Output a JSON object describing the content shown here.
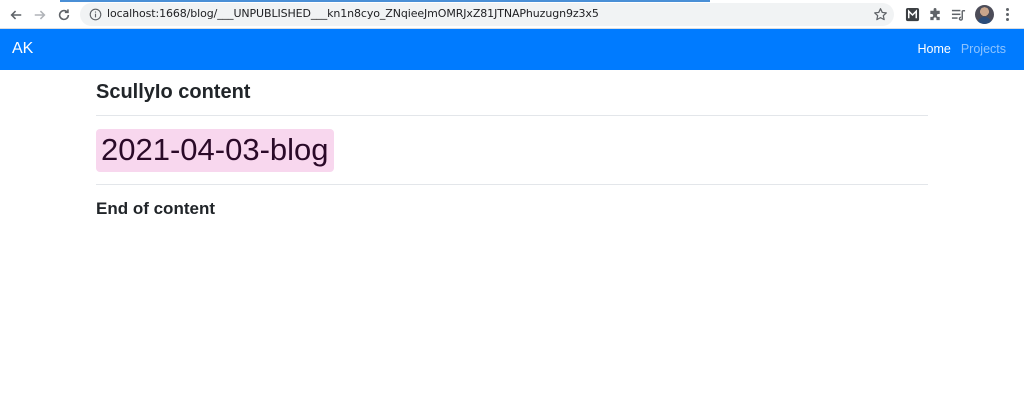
{
  "browser": {
    "url": "localhost:1668/blog/___UNPUBLISHED___kn1n8cyo_ZNqieeJmOMRJxZ81JTNAPhuzugn9z3x5",
    "icons": [
      "back-arrow-icon",
      "forward-arrow-icon",
      "reload-icon",
      "info-icon",
      "star-icon",
      "m-extension-icon",
      "puzzle-icon",
      "playlist-icon",
      "profile-avatar",
      "menu-dots-icon"
    ]
  },
  "navbar": {
    "brand": "AK",
    "links": [
      {
        "label": "Home",
        "active": true
      },
      {
        "label": "Projects",
        "active": false
      }
    ],
    "color": "#007bff"
  },
  "content": {
    "heading": "ScullyIo content",
    "date_title": "2021-04-03-blog",
    "date_bg": "#f8d7ee",
    "footer_text": "End of content"
  }
}
